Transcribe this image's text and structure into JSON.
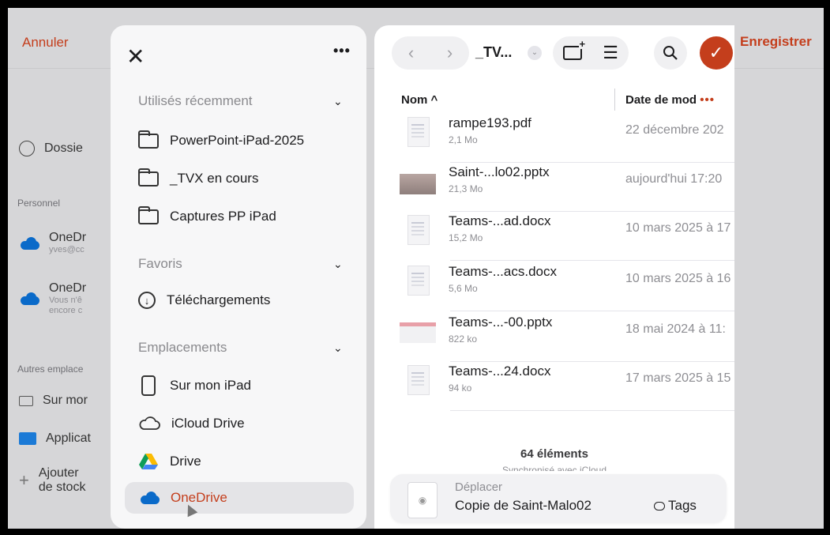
{
  "background": {
    "cancel_label": "Annuler",
    "save_label": "Enregistrer",
    "recent_label": "Dossie",
    "personal_section": "Personnel",
    "onedrive1_name": "OneDr",
    "onedrive1_sub": "yves@cc",
    "onedrive2_name": "OneDr",
    "onedrive2_sub1": "Vous n'ê",
    "onedrive2_sub2": "encore c",
    "other_section": "Autres emplace",
    "on_ipad_label": "Sur mor",
    "apps_label": "Applicat",
    "add_storage_line1": "Ajouter",
    "add_storage_line2": "de stock"
  },
  "sidebar": {
    "close_glyph": "✕",
    "more_glyph": "•••",
    "recent_title": "Utilisés récemment",
    "recent_items": [
      "PowerPoint-iPad-2025",
      "_TVX en cours",
      "Captures PP iPad"
    ],
    "favorites_title": "Favoris",
    "downloads_label": "Téléchargements",
    "locations_title": "Emplacements",
    "locations": [
      "Sur mon iPad",
      "iCloud Drive",
      "Drive",
      "OneDrive"
    ],
    "selected_location": "OneDrive"
  },
  "toolbar": {
    "back_glyph": "‹",
    "forward_glyph": "›",
    "path_title": "_TV...",
    "path_chevron": "⌄",
    "list_glyph": "☰",
    "done_glyph": "✓"
  },
  "columns": {
    "name_header": "Nom ^",
    "date_header": "Date de mod",
    "date_more": "•••"
  },
  "files": [
    {
      "name": "rampe193.pdf",
      "size": "2,1 Mo",
      "date": "22 décembre 202",
      "thumb": "doc"
    },
    {
      "name": "Saint-...lo02.pptx",
      "size": "21,3 Mo",
      "date": "aujourd'hui 17:20",
      "thumb": "slide"
    },
    {
      "name": "Teams-...ad.docx",
      "size": "15,2 Mo",
      "date": "10 mars 2025 à 17",
      "thumb": "doc"
    },
    {
      "name": "Teams-...acs.docx",
      "size": "5,6 Mo",
      "date": "10 mars 2025 à 16",
      "thumb": "doc"
    },
    {
      "name": "Teams-...-00.pptx",
      "size": "822 ko",
      "date": "18 mai 2024 à 11:",
      "thumb": "slide-light"
    },
    {
      "name": "Teams-...24.docx",
      "size": "94 ko",
      "date": "17 mars 2025 à 15",
      "thumb": "doc"
    }
  ],
  "footer": {
    "count": "64 éléments",
    "sync": "Synchronisé avec iCloud"
  },
  "bottom_bar": {
    "action_label": "Déplacer",
    "file_name": "Copie de Saint-Malo02",
    "tags_label": "Tags"
  },
  "colors": {
    "accent": "#c43e1c",
    "onedrive_blue": "#0a6ac9"
  }
}
